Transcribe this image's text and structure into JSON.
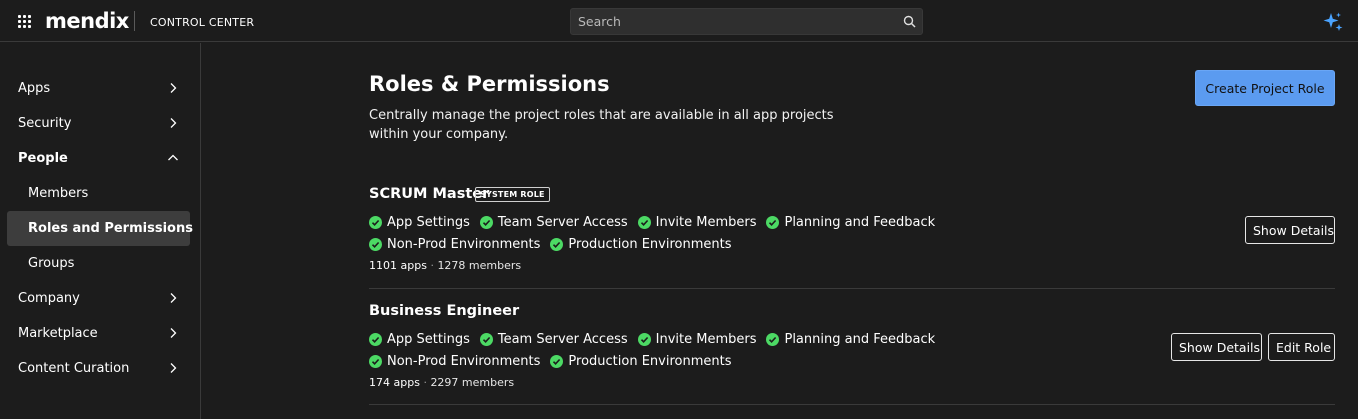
{
  "header": {
    "brand": "mendix",
    "section": "CONTROL CENTER",
    "search_placeholder": "Search",
    "icons": [
      "app-grid-icon",
      "search-icon",
      "sparkle-icon"
    ]
  },
  "sidebar": {
    "items": [
      {
        "label": "Apps"
      },
      {
        "label": "Security"
      },
      {
        "label": "People"
      },
      {
        "label": "Members"
      },
      {
        "label": "Roles and Permissions"
      },
      {
        "label": "Groups"
      },
      {
        "label": "Company"
      },
      {
        "label": "Marketplace"
      },
      {
        "label": "Content Curation"
      }
    ]
  },
  "main": {
    "title": "Roles & Permissions",
    "description": "Centrally manage the project roles that are available in all app projects within your company.",
    "create_button": "Create Project Role",
    "roles": [
      {
        "name": "SCRUM Master",
        "badge": "SYSTEM ROLE",
        "permissions": [
          "App Settings",
          "Team Server Access",
          "Invite Members",
          "Planning and Feedback",
          "Non-Prod Environments",
          "Production Environments"
        ],
        "apps": "1101 apps",
        "separator": "·",
        "members": "1278 members",
        "show_details": "Show Details"
      },
      {
        "name": "Business Engineer",
        "permissions": [
          "App Settings",
          "Team Server Access",
          "Invite Members",
          "Planning and Feedback",
          "Non-Prod Environments",
          "Production Environments"
        ],
        "apps": "174 apps",
        "separator": "·",
        "members": "2297 members",
        "show_details": "Show Details",
        "edit_role": "Edit Role"
      }
    ]
  },
  "colors": {
    "background": "#1c1c1c",
    "accent": "#5b9bf0",
    "check": "#4cd964",
    "active_nav": "#3d3d3d",
    "sparkle": "#4aa3ff"
  }
}
